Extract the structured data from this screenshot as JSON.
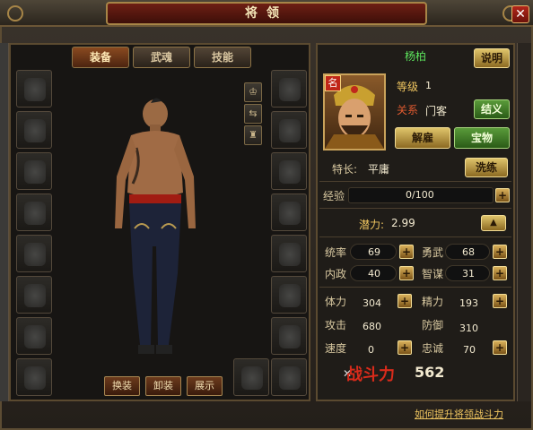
{
  "window": {
    "title": "将领",
    "close_label": "✕"
  },
  "tabs": [
    {
      "label": "装备",
      "active": true
    },
    {
      "label": "武魂",
      "active": false
    },
    {
      "label": "技能",
      "active": false
    }
  ],
  "character": {
    "name": "杨柏",
    "badge": "名",
    "level_label": "等级",
    "level_value": "1",
    "relation_label": "关系",
    "relation_value": "门客",
    "specialty_label": "特长:",
    "specialty_value": "平庸"
  },
  "buttons": {
    "explain": "说明",
    "sworn": "结义",
    "dismiss": "解雇",
    "treasure": "宝物",
    "retrain": "洗练",
    "swap": "换装",
    "unequip": "卸装",
    "show": "展示"
  },
  "experience": {
    "label": "经验",
    "value": "0/100",
    "progress": 0.0
  },
  "potential": {
    "label": "潜力:",
    "value": "2.99"
  },
  "stats": [
    {
      "label": "统率",
      "value": "69"
    },
    {
      "label": "勇武",
      "value": "68"
    },
    {
      "label": "内政",
      "value": "40"
    },
    {
      "label": "智谋",
      "value": "31"
    },
    {
      "label": "体力",
      "value": "304"
    },
    {
      "label": "精力",
      "value": "193"
    },
    {
      "label": "攻击",
      "value": "680"
    },
    {
      "label": "防御",
      "value": "310"
    },
    {
      "label": "速度",
      "value": "0"
    },
    {
      "label": "忠诚",
      "value": "70"
    }
  ],
  "combat_power": {
    "label": "战斗力",
    "value": "562"
  },
  "help_link": "如何提升将领战斗力",
  "colors": {
    "name": "#5ce25c",
    "power": "#d82b1b",
    "accent": "#c9a25a"
  }
}
